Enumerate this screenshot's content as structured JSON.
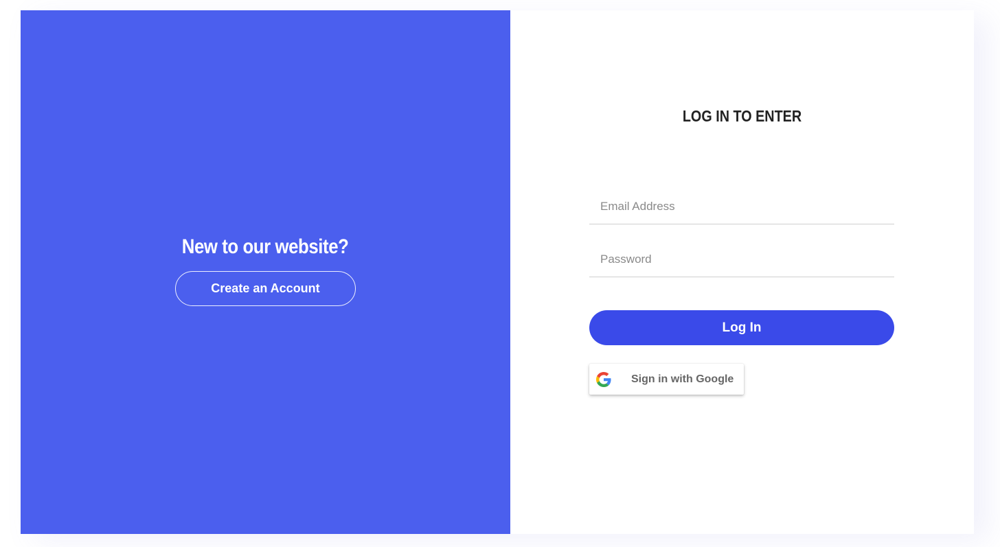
{
  "signup_panel": {
    "title": "New to our website?",
    "create_account_label": "Create an Account",
    "background_color": "#4b5fee"
  },
  "login_panel": {
    "title": "LOG IN TO ENTER",
    "email": {
      "placeholder": "Email Address",
      "value": ""
    },
    "password": {
      "placeholder": "Password",
      "value": ""
    },
    "login_label": "Log In",
    "login_color": "#3a4ae9",
    "google_label": "Sign in with Google",
    "google_icon": "google-g-icon"
  }
}
